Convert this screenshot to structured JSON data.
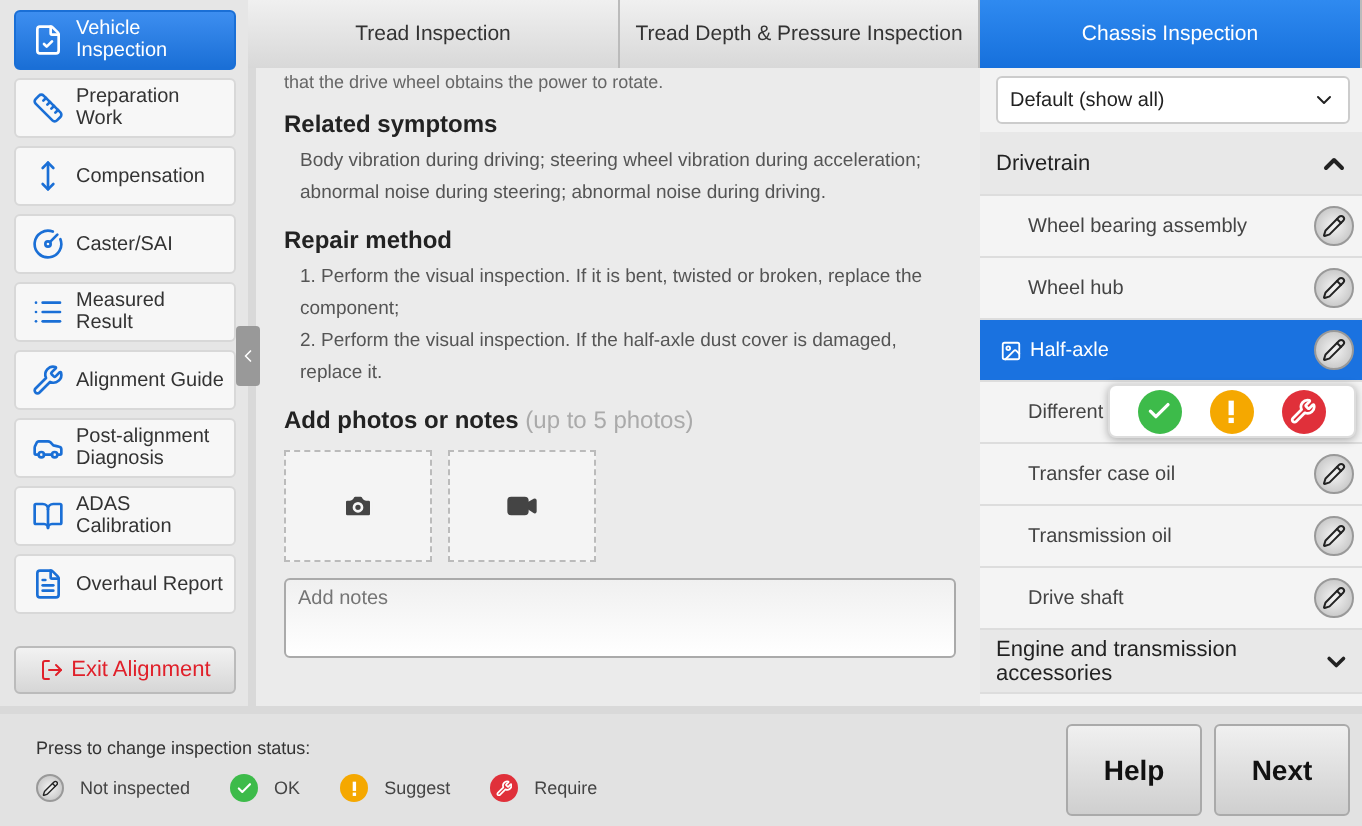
{
  "sidebar": {
    "items": [
      {
        "label": "Vehicle Inspection",
        "selected": true
      },
      {
        "label": "Preparation Work",
        "selected": false
      },
      {
        "label": "Compensation",
        "selected": false
      },
      {
        "label": "Caster/SAI",
        "selected": false
      },
      {
        "label": "Measured Result",
        "selected": false
      },
      {
        "label": "Alignment Guide",
        "selected": false
      },
      {
        "label": "Post-alignment Diagnosis",
        "selected": false
      },
      {
        "label": "ADAS Calibration",
        "selected": false
      },
      {
        "label": "Overhaul Report",
        "selected": false
      }
    ],
    "exit_button": "Exit Alignment"
  },
  "tabs": [
    {
      "label": "Tread Inspection",
      "selected": false
    },
    {
      "label": "Tread Depth & Pressure Inspection",
      "selected": false
    },
    {
      "label": "Chassis Inspection",
      "selected": true
    }
  ],
  "content": {
    "intro": "that the drive wheel obtains the power to rotate.",
    "sections": [
      {
        "heading": "Related symptoms",
        "paragraphs": [
          "Body vibration during driving; steering wheel vibration during acceleration; abnormal noise during steering; abnormal noise during driving."
        ]
      },
      {
        "heading": "Repair method",
        "paragraphs": [
          "1. Perform the visual inspection. If it is bent, twisted or broken, replace the component;",
          "2. Perform the visual inspection. If the half-axle dust cover is damaged, replace it."
        ]
      }
    ],
    "media_heading": "Add photos or notes",
    "media_hint": "(up to 5 photos)",
    "notes_placeholder": "Add notes"
  },
  "filter": {
    "value": "Default (show all)"
  },
  "groups": [
    {
      "title": "Drivetrain",
      "expanded": true,
      "items": [
        {
          "label": "Wheel bearing assembly",
          "selected": false
        },
        {
          "label": "Wheel hub",
          "selected": false
        },
        {
          "label": "Half-axle",
          "selected": true
        },
        {
          "label": "Different",
          "selected": false
        },
        {
          "label": "Transfer case oil",
          "selected": false
        },
        {
          "label": "Transmission oil",
          "selected": false
        },
        {
          "label": "Drive shaft",
          "selected": false
        }
      ]
    },
    {
      "title": "Engine and transmission accessories",
      "expanded": false
    }
  ],
  "status_popover": {
    "options": [
      {
        "kind": "ok"
      },
      {
        "kind": "suggest"
      },
      {
        "kind": "require"
      }
    ]
  },
  "footer": {
    "hint": "Press to change inspection status:",
    "legend": [
      {
        "kind": "not_inspected",
        "label": "Not inspected"
      },
      {
        "kind": "ok",
        "label": "OK"
      },
      {
        "kind": "suggest",
        "label": "Suggest"
      },
      {
        "kind": "require",
        "label": "Require"
      }
    ],
    "buttons": [
      "Help",
      "Next"
    ]
  }
}
